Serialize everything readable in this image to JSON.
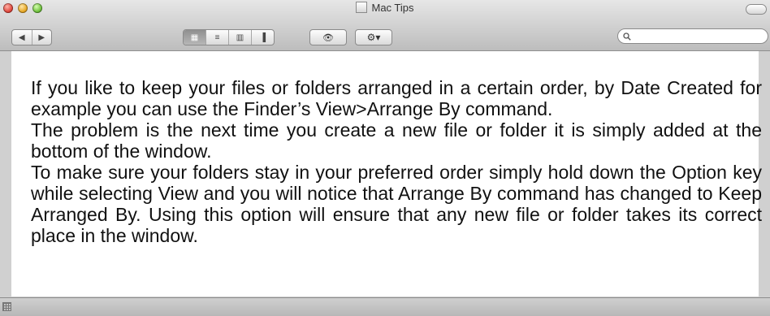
{
  "window": {
    "title": "Mac Tips"
  },
  "toolbar": {
    "back_glyph": "◀",
    "forward_glyph": "▶",
    "view_modes": [
      {
        "icon": "icon-view-icon",
        "glyph": "▦",
        "active": true
      },
      {
        "icon": "list-view-icon",
        "glyph": "≡",
        "active": false
      },
      {
        "icon": "column-view-icon",
        "glyph": "▥",
        "active": false
      },
      {
        "icon": "coverflow-view-icon",
        "glyph": "▐",
        "active": false
      }
    ],
    "quicklook_glyph": "👁",
    "action_glyph": "⚙▾"
  },
  "search": {
    "placeholder": "",
    "value": ""
  },
  "content": {
    "paragraphs": [
      "If you like to keep your files or folders arranged in a certain order, by Date Created for example you can use the Finder’s View>Arrange By command.",
      "The problem is the next time you create a new file or folder it is simply added at the bottom of the window.",
      "To make sure your folders stay in your preferred order simply hold down the Option key while selecting View and you will notice that Arrange By command has changed to Keep Arranged By. Using this option will ensure that any new file or folder takes its correct place in the window."
    ]
  },
  "colors": {
    "chrome": "#d0d0d0",
    "content_bg": "#ffffff",
    "text": "#111111"
  }
}
